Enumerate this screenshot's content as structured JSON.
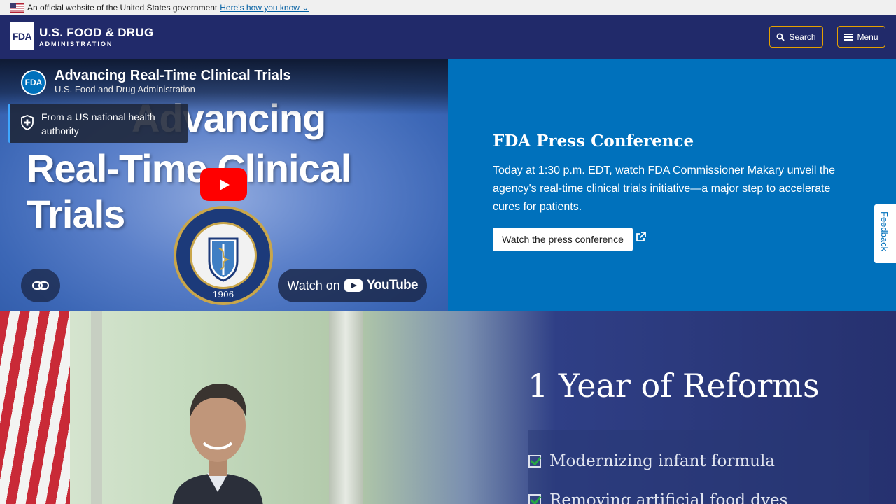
{
  "gov_banner": {
    "text": "An official website of the United States government",
    "link": "Here's how you know"
  },
  "header": {
    "logo_mark": "FDA",
    "logo_title": "U.S. FOOD & DRUG",
    "logo_subtitle": "ADMINISTRATION",
    "search_label": "Search",
    "menu_label": "Menu",
    "accent_color": "#e5a000",
    "bg_color": "#212a6a"
  },
  "video": {
    "channel_avatar": "FDA",
    "title": "Advancing Real-Time Clinical Trials",
    "channel": "U.S. Food and Drug Administration",
    "headline_line1": "Advancing",
    "headline_line2": "Real-Time Clinical Trials",
    "health_badge": "From a US national health authority",
    "watch_on": "Watch on",
    "youtube": "YouTube",
    "seal_text": "FOOD AND DRUG ADMINISTRATION",
    "seal_year": "1906"
  },
  "press": {
    "title": "FDA Press Conference",
    "body": "Today at 1:30 p.m. EDT, watch FDA Commissioner Makary unveil the agency's real-time clinical trials initiative—a major step to accelerate cures for patients.",
    "button": "Watch the press conference",
    "bg_color": "#0071bc"
  },
  "feedback": {
    "label": "Feedback"
  },
  "reforms": {
    "title": "1 Year of Reforms",
    "items": [
      "Modernizing infant formula",
      "Removing artificial food dyes"
    ]
  }
}
